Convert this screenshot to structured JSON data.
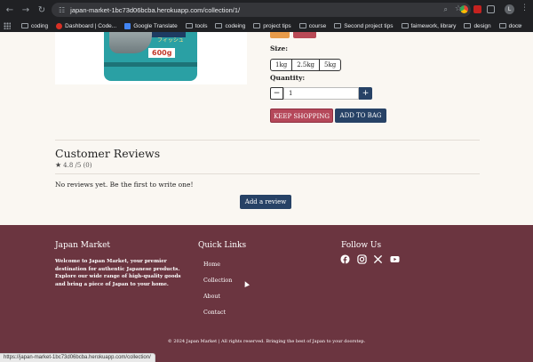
{
  "browser": {
    "url": "japan-market-1bc73d06bcba.herokuapp.com/collection/1/",
    "bookmarks": [
      {
        "label": "coding",
        "icon": "folder-icon"
      },
      {
        "label": "Dashboard | Code...",
        "icon": "dashboard-favicon"
      },
      {
        "label": "Google Translate",
        "icon": "translate-favicon"
      },
      {
        "label": "tools",
        "icon": "folder-icon"
      },
      {
        "label": "codeing",
        "icon": "folder-icon"
      },
      {
        "label": "project tips",
        "icon": "folder-icon"
      },
      {
        "label": "course",
        "icon": "folder-icon"
      },
      {
        "label": "Second project tips",
        "icon": "folder-icon"
      },
      {
        "label": "faimework, library",
        "icon": "folder-icon"
      },
      {
        "label": "design",
        "icon": "folder-icon"
      },
      {
        "label": "docu",
        "icon": "folder-icon"
      }
    ],
    "more_bookmarks": "»",
    "profile_initial": "L",
    "status_url": "https://japan-market-1bc73d06bcba.herokuapp.com/collection/"
  },
  "product": {
    "package_weight": "600g",
    "size_label": "Size:",
    "sizes": [
      "1kg",
      "2.5kg",
      "5kg"
    ],
    "quantity_label": "Quantity:",
    "quantity_value": "1",
    "keep_shopping": "KEEP SHOPPING",
    "add_to_bag": "ADD TO BAG"
  },
  "reviews": {
    "title": "Customer Reviews",
    "rating_text": "4.8 /5 (0)",
    "empty_text": "No reviews yet. Be the first to write one!",
    "add_button": "Add a review"
  },
  "footer": {
    "brand": "Japan Market",
    "about": "Welcome to Japan Market, your premier destination for authentic Japanese products. Explore our wide range of high-quality goods and bring a piece of Japan to your home.",
    "quick_links_title": "Quick Links",
    "links": [
      "Home",
      "Collection",
      "About",
      "Contact"
    ],
    "follow_title": "Follow Us",
    "social": [
      "facebook-icon",
      "instagram-icon",
      "x-icon",
      "youtube-icon"
    ],
    "copyright": "© 2024 Japan Market | All rights reserved. Bringing the best of Japan to your doorstep."
  },
  "colors": {
    "primary": "#274266",
    "accent": "#b5485a",
    "footer_bg": "#6b3540",
    "page_bg": "#faf7f2"
  }
}
